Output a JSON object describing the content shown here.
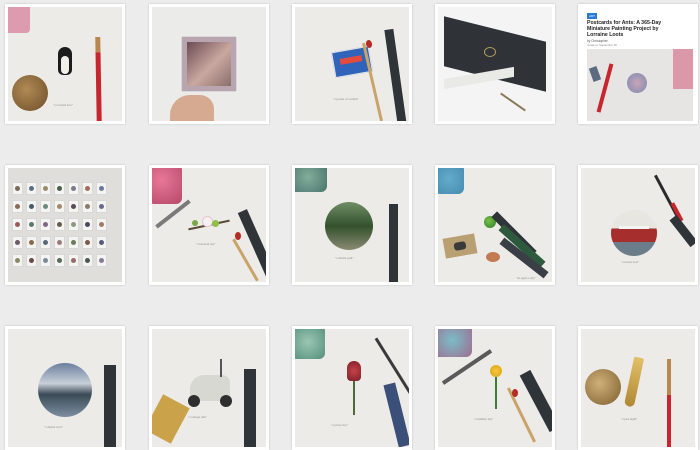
{
  "tiles": [
    {
      "id": "penguin",
      "caption": "\"a colonial love\""
    },
    {
      "id": "polaroid",
      "caption": ""
    },
    {
      "id": "matchbox",
      "caption": "\"a pocket of warmth\""
    },
    {
      "id": "book",
      "caption": ""
    },
    {
      "id": "blog",
      "caption": "",
      "tag": "ART",
      "title": "Postcards for Ants: A 365-Day Miniature Painting Project by Lorraine Loots",
      "author": "by Christopher",
      "date": "Jonas on September 18"
    },
    {
      "id": "collection-grid",
      "caption": ""
    },
    {
      "id": "blossom",
      "caption": "\"a blossom day\""
    },
    {
      "id": "forest",
      "caption": "\"a distant path\""
    },
    {
      "id": "apple",
      "caption": "\"an apple a day\""
    },
    {
      "id": "boat",
      "caption": "\"a rescue boat\""
    },
    {
      "id": "sea",
      "caption": "\"a distant view\""
    },
    {
      "id": "scooter",
      "caption": "\"a vintage ride\""
    },
    {
      "id": "protea",
      "caption": "\"a protea day\""
    },
    {
      "id": "flower",
      "caption": "\"a summer day\""
    },
    {
      "id": "saxophone",
      "caption": "\"a jazz night\""
    }
  ],
  "colors": {
    "background": "#ececec",
    "paper": "#ecebe7",
    "pencil_dark": "#2f3439",
    "brush_red": "#c8262e"
  }
}
